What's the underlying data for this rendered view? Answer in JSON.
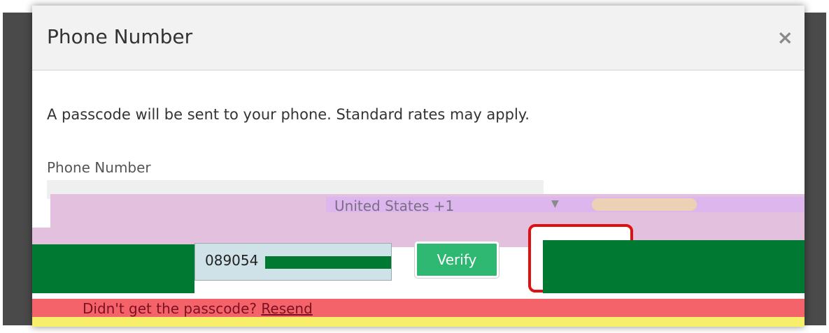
{
  "modal": {
    "title": "Phone Number",
    "close_label": "×",
    "description": "A passcode will be sent to your phone. Standard rates may apply.",
    "field_label": "Phone Number"
  },
  "country_select": {
    "selected": "United States +1",
    "caret_icon": "chevron-down-icon"
  },
  "phone_input": {
    "value": "089054"
  },
  "verify_button": {
    "label": "Verify"
  },
  "resend": {
    "prompt": "Didn't get the passcode?",
    "link_label": "Resend"
  },
  "colors": {
    "verify_green": "#2eb872",
    "highlight_red": "#e01010",
    "header_bg": "#f2f2f2"
  }
}
